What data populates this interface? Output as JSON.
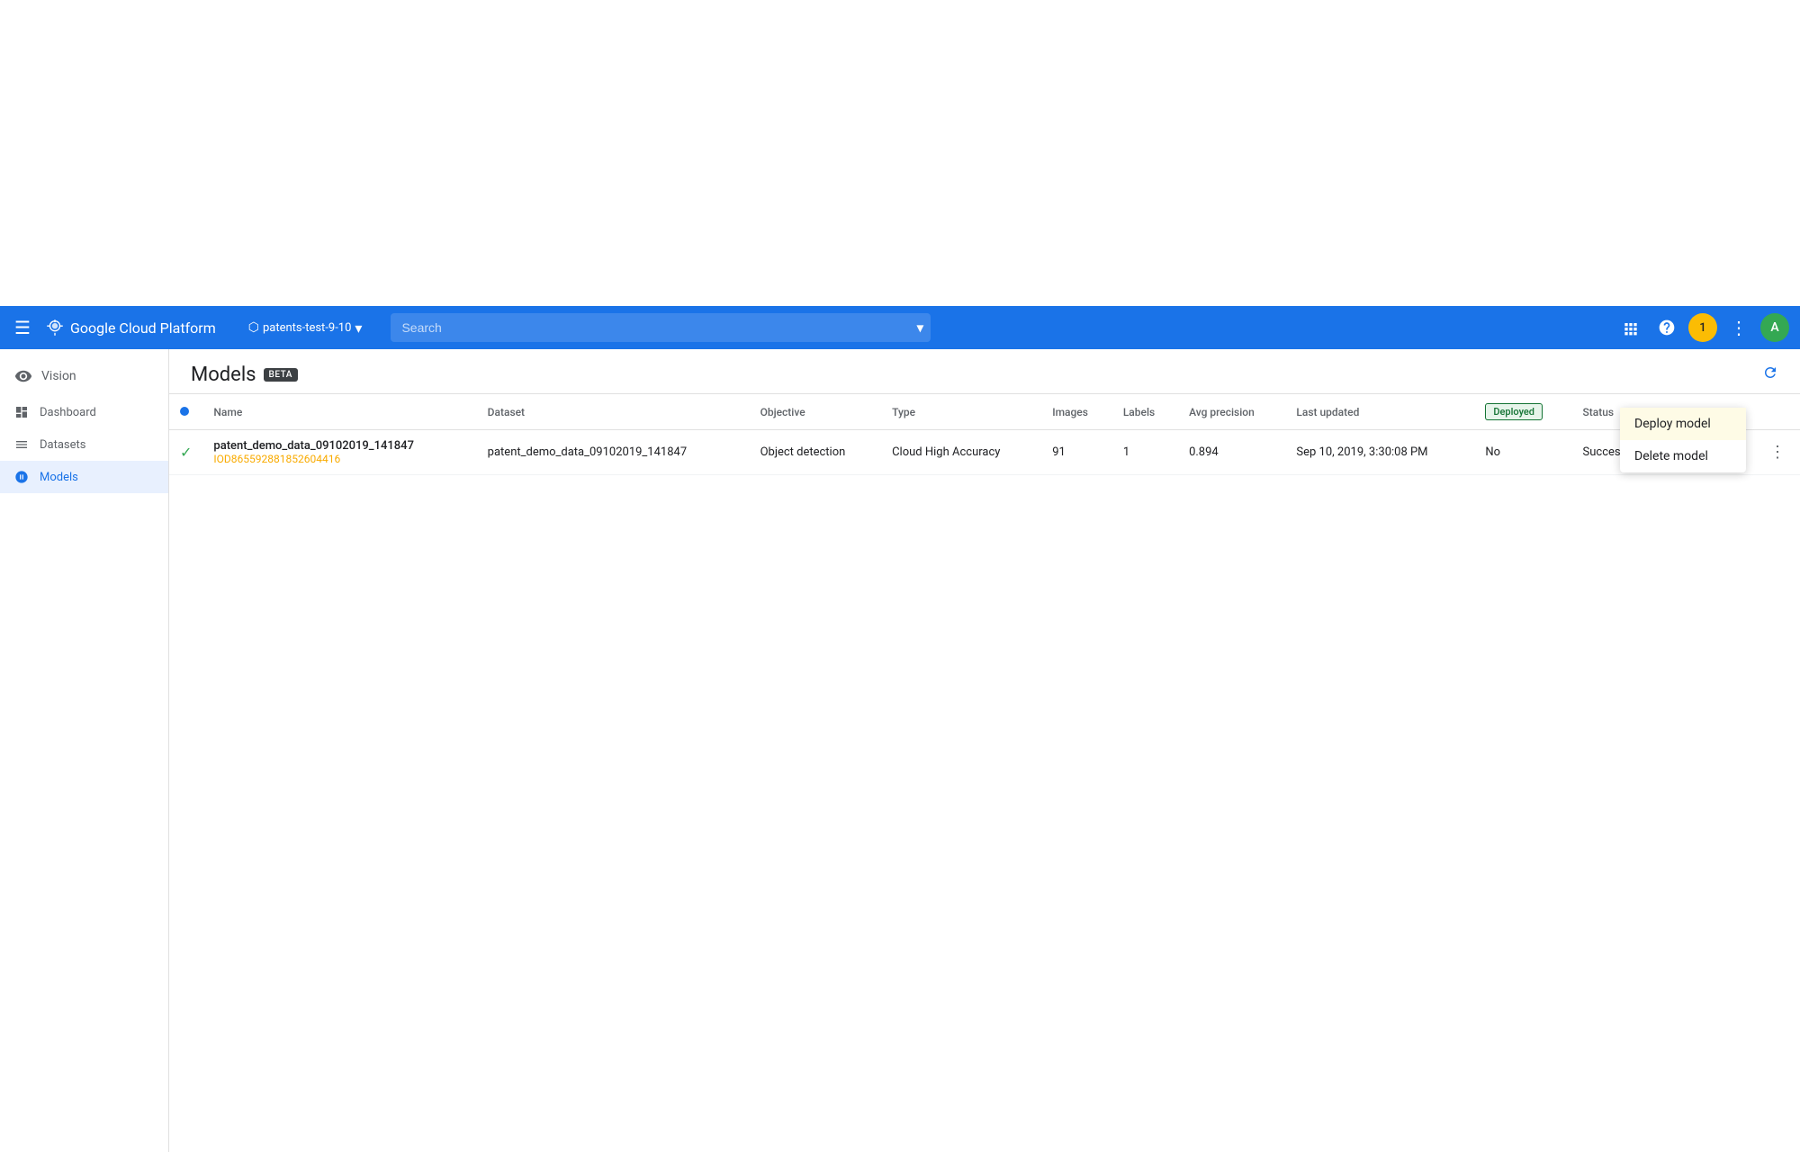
{
  "navbar": {
    "hamburger": "☰",
    "brand_name": "Google Cloud Platform",
    "project_icon": "⬡",
    "project_name": "patents-test-9-10",
    "search_placeholder": "Search",
    "icons": {
      "apps": "⊞",
      "help": "?",
      "notification": "1",
      "more": "⋮",
      "user_initial": "A"
    }
  },
  "sidebar": {
    "section": "Vision",
    "items": [
      {
        "label": "Dashboard",
        "icon": "dashboard",
        "active": false
      },
      {
        "label": "Datasets",
        "icon": "datasets",
        "active": false
      },
      {
        "label": "Models",
        "icon": "models",
        "active": true
      }
    ]
  },
  "content": {
    "title": "Models",
    "beta_label": "BETA",
    "table": {
      "columns": [
        {
          "key": "status_dot",
          "label": ""
        },
        {
          "key": "name",
          "label": "Name"
        },
        {
          "key": "dataset",
          "label": "Dataset"
        },
        {
          "key": "objective",
          "label": "Objective"
        },
        {
          "key": "type",
          "label": "Type"
        },
        {
          "key": "images",
          "label": "Images"
        },
        {
          "key": "labels",
          "label": "Labels"
        },
        {
          "key": "avg_precision",
          "label": "Avg precision"
        },
        {
          "key": "last_updated",
          "label": "Last updated"
        },
        {
          "key": "deployed",
          "label": "Deployed"
        },
        {
          "key": "status_text",
          "label": "Status"
        },
        {
          "key": "actions",
          "label": ""
        }
      ],
      "rows": [
        {
          "check": "✓",
          "name": "patent_demo_data_09102019_141847",
          "model_id": "IOD865592881852604416",
          "dataset": "patent_demo_data_09102019_141847",
          "objective": "Object detection",
          "type": "Cloud High Accuracy",
          "images": "91",
          "labels": "1",
          "avg_precision": "0.894",
          "last_updated": "Sep 10, 2019, 3:30:08 PM",
          "deployed": "No",
          "status": "Success: Training model"
        }
      ]
    }
  },
  "dropdown": {
    "items": [
      {
        "label": "Deploy model",
        "highlighted": true
      },
      {
        "label": "Delete model",
        "highlighted": false
      }
    ]
  }
}
